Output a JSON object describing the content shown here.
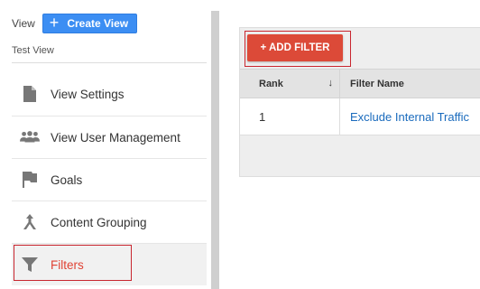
{
  "left_panel": {
    "view_label": "View",
    "create_view_label": "Create View",
    "view_name": "Test View",
    "nav_items": [
      {
        "label": "View Settings",
        "icon": "document-icon"
      },
      {
        "label": "View User Management",
        "icon": "people-icon"
      },
      {
        "label": "Goals",
        "icon": "flag-icon"
      },
      {
        "label": "Content Grouping",
        "icon": "content-grouping-icon"
      },
      {
        "label": "Filters",
        "icon": "filter-icon",
        "active": true
      }
    ]
  },
  "filters_panel": {
    "add_filter_label": "+ ADD FILTER",
    "table": {
      "columns": [
        {
          "label": "Rank",
          "sort": "descending"
        },
        {
          "label": "Filter Name"
        }
      ],
      "rows": [
        {
          "rank": "1",
          "name": "Exclude Internal Traffic"
        }
      ]
    }
  },
  "colors": {
    "primary_blue": "#3c8ef3",
    "add_filter_red": "#dc4a38",
    "active_nav_text": "#e04234",
    "link_blue": "#1a6bbd",
    "highlight_border": "#c8262f"
  }
}
